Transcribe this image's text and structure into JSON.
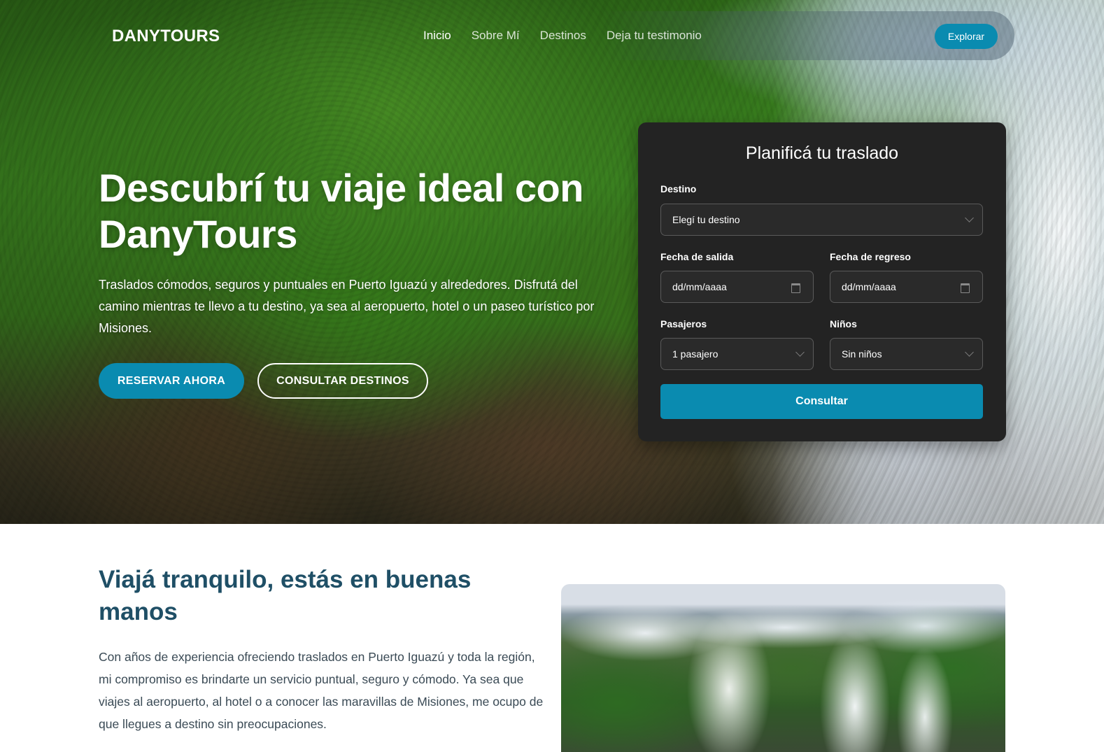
{
  "nav": {
    "brand": "DANYTOURS",
    "links": [
      "Inicio",
      "Sobre Mí",
      "Destinos",
      "Deja tu testimonio"
    ],
    "cta": "Explorar"
  },
  "hero": {
    "title": "Descubrí tu viaje ideal con DanyTours",
    "text": "Traslados cómodos, seguros y puntuales en Puerto Iguazú y alrededores. Disfrutá del camino mientras te llevo a tu destino, ya sea al aeropuerto, hotel o un paseo turístico por Misiones.",
    "primary_button": "RESERVAR AHORA",
    "secondary_button": "CONSULTAR DESTINOS"
  },
  "form": {
    "title": "Planificá tu traslado",
    "destination_label": "Destino",
    "destination_value": "Elegí tu destino",
    "departure_label": "Fecha de salida",
    "departure_value": "dd/mm/aaaa",
    "return_label": "Fecha de regreso",
    "return_value": "dd/mm/aaaa",
    "passengers_label": "Pasajeros",
    "passengers_value": "1 pasajero",
    "children_label": "Niños",
    "children_value": "Sin niños",
    "submit": "Consultar"
  },
  "about": {
    "title": "Viajá tranquilo, estás en buenas manos",
    "text": "Con años de experiencia ofreciendo traslados en Puerto Iguazú y toda la región, mi compromiso es brindarte un servicio puntual, seguro y cómodo. Ya sea que viajes al aeropuerto, al hotel o a conocer las maravillas de Misiones, me ocupo de que llegues a destino sin preocupaciones."
  },
  "colors": {
    "accent": "#0a8bb0",
    "card_bg": "#232323",
    "heading": "#1f4f66"
  }
}
